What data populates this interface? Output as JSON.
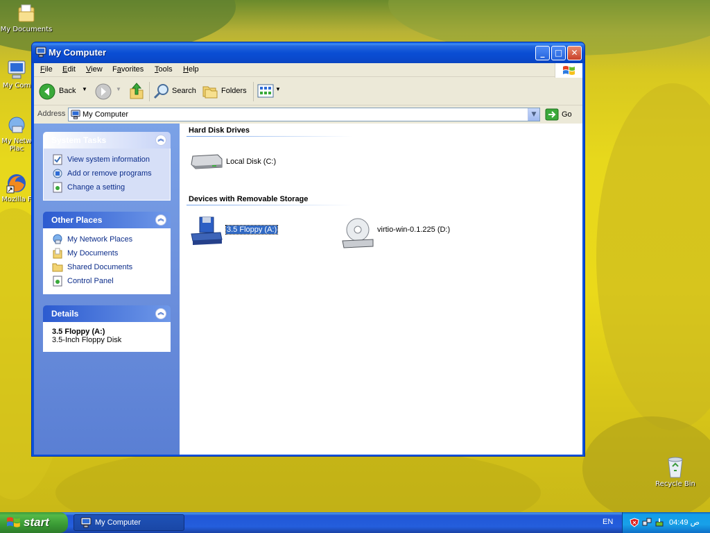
{
  "desktop": {
    "icons": [
      {
        "label": "My Documents"
      },
      {
        "label": "My Com"
      },
      {
        "label": "My Netw"
      },
      {
        "label": "Plac"
      },
      {
        "label": "Mozilla F"
      },
      {
        "label": "Recycle Bin"
      }
    ]
  },
  "window": {
    "title": "My Computer",
    "controls": {
      "minimize": "_",
      "maximize": "□",
      "close": "✕"
    }
  },
  "menubar": {
    "items": [
      {
        "label": "File",
        "mnemonic": "F",
        "rest": "ile"
      },
      {
        "label": "Edit",
        "mnemonic": "E",
        "rest": "dit"
      },
      {
        "label": "View",
        "mnemonic": "V",
        "rest": "iew"
      },
      {
        "label": "Favorites",
        "mnemonic": "a",
        "pre": "F",
        "rest": "vorites"
      },
      {
        "label": "Tools",
        "mnemonic": "T",
        "rest": "ools"
      },
      {
        "label": "Help",
        "mnemonic": "H",
        "rest": "elp"
      }
    ]
  },
  "toolbar": {
    "back_label": "Back",
    "search_label": "Search",
    "folders_label": "Folders"
  },
  "address": {
    "label": "Address",
    "value": "My Computer",
    "go_label": "Go"
  },
  "left_pane": {
    "system_tasks": {
      "title": "System Tasks",
      "items": [
        "View system information",
        "Add or remove programs",
        "Change a setting"
      ]
    },
    "other_places": {
      "title": "Other Places",
      "items": [
        "My Network Places",
        "My Documents",
        "Shared Documents",
        "Control Panel"
      ]
    },
    "details": {
      "title": "Details",
      "name": "3.5 Floppy (A:)",
      "description": "3.5-Inch Floppy Disk"
    }
  },
  "content": {
    "groups": [
      {
        "title": "Hard Disk Drives",
        "items": [
          {
            "label": "Local Disk (C:)",
            "icon": "hard-disk-icon"
          }
        ]
      },
      {
        "title": "Devices with Removable Storage",
        "items": [
          {
            "label": "3.5 Floppy (A:)",
            "icon": "floppy-drive-icon",
            "selected": true
          },
          {
            "label": "virtio-win-0.1.225 (D:)",
            "icon": "cd-drive-icon"
          }
        ]
      }
    ]
  },
  "taskbar": {
    "start_label": "start",
    "task_label": "My Computer",
    "language": "EN",
    "clock": "ص 04:49"
  },
  "colors": {
    "title_blue": "#0a4ed4",
    "selection": "#316ac5",
    "task_link": "#0c2d8a",
    "panel_title": "#215dc6"
  }
}
